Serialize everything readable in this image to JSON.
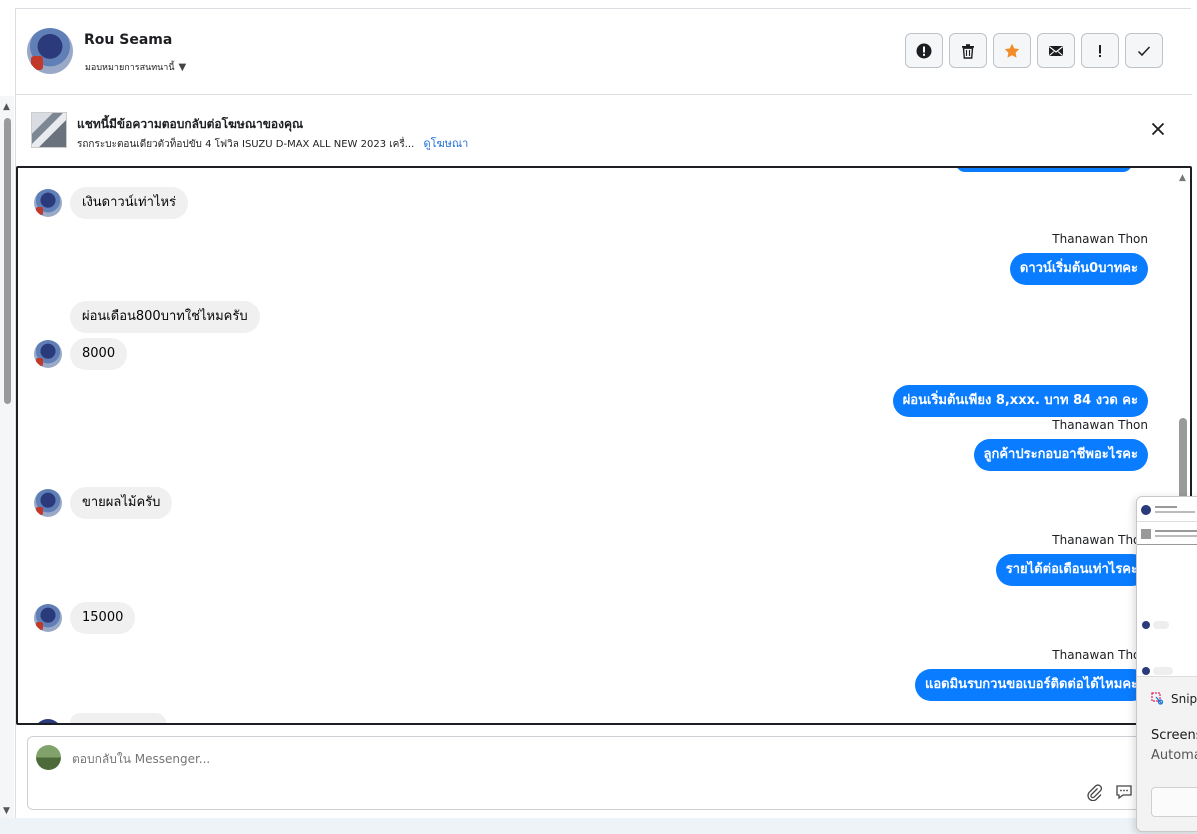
{
  "header": {
    "contact_name": "Rou Seama",
    "assign_label": "มอบหมายการสนทนานี้",
    "toolbar": [
      {
        "name": "report-spam",
        "icon": "exclamation-circle-icon"
      },
      {
        "name": "delete",
        "icon": "trash-icon"
      },
      {
        "name": "star",
        "icon": "star-icon"
      },
      {
        "name": "mark-unread",
        "icon": "envelope-icon"
      },
      {
        "name": "follow-up",
        "icon": "exclamation-icon"
      },
      {
        "name": "mark-done",
        "icon": "check-icon"
      }
    ]
  },
  "ad": {
    "title": "แชทนี้มีข้อความตอบกลับต่อโฆษณาของคุณ",
    "description": "รถกระบะตอนเดียวตัวท็อปขับ 4 โฟวิล ISUZU D-MAX ALL NEW 2023 เครื่...",
    "link_label": "ดูโฆษณา"
  },
  "messages": [
    {
      "id": 1,
      "type": "in",
      "text": "เงินดาวน์เท่าไหร่"
    },
    {
      "id": 2,
      "type": "out",
      "sender": "Thanawan Thon",
      "text": "ดาวน์เริ่มต้น0บาทคะ"
    },
    {
      "id": 3,
      "type": "in",
      "text": "ผ่อนเดือน800บาทใช่ไหมครับ"
    },
    {
      "id": 4,
      "type": "in",
      "text": "8000"
    },
    {
      "id": 5,
      "type": "out",
      "text": "ผ่อนเริ่มต้นเพียง 8,xxx. บาท 84 งวด คะ"
    },
    {
      "id": 6,
      "type": "out",
      "sender": "Thanawan Thon",
      "text": "ลูกค้าประกอบอาชีพอะไรคะ"
    },
    {
      "id": 7,
      "type": "in",
      "text": "ขายผลไม้ครับ"
    },
    {
      "id": 8,
      "type": "out",
      "sender": "Thanawan Thon",
      "text": "รายได้ต่อเดือนเท่าไรคะ"
    },
    {
      "id": 9,
      "type": "in",
      "text": "15000"
    },
    {
      "id": 10,
      "type": "out",
      "sender": "Thanawan Thon",
      "text": "แอดมินรบกวนขอเบอร์ติดต่อได้ไหมคะ"
    }
  ],
  "composer": {
    "placeholder": "ตอบกลับใน Messenger...",
    "icons": [
      "paperclip-icon",
      "chat-bubble-icon",
      "emoji-icon",
      "baht-icon"
    ],
    "baht_symbol": "฿"
  },
  "snip_overlay": {
    "app_name": "Snip",
    "title": "Screens",
    "subtitle": "Automa"
  },
  "colors": {
    "outgoing_bubble": "#0a7cff",
    "incoming_bubble": "#f0f0f0",
    "star": "#f28c28",
    "link": "#216fdb"
  }
}
